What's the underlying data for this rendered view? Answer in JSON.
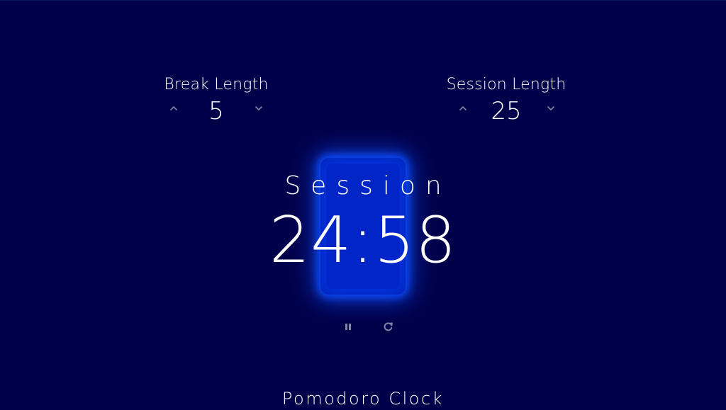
{
  "app": {
    "title": "Pomodoro Clock"
  },
  "break": {
    "label": "Break Length",
    "value": "5",
    "increment_icon": "chevron-up-icon",
    "decrement_icon": "chevron-down-icon"
  },
  "session": {
    "label": "Session Length",
    "value": "25",
    "increment_icon": "chevron-up-icon",
    "decrement_icon": "chevron-down-icon"
  },
  "timer": {
    "label": "Session",
    "time_left": "24:58"
  },
  "controls": {
    "pause_icon": "pause-icon",
    "reset_icon": "refresh-icon"
  },
  "colors": {
    "background": "#00004a",
    "glow": "#0a4dff",
    "text": "#ffffff",
    "icon": "#7d87a6"
  }
}
